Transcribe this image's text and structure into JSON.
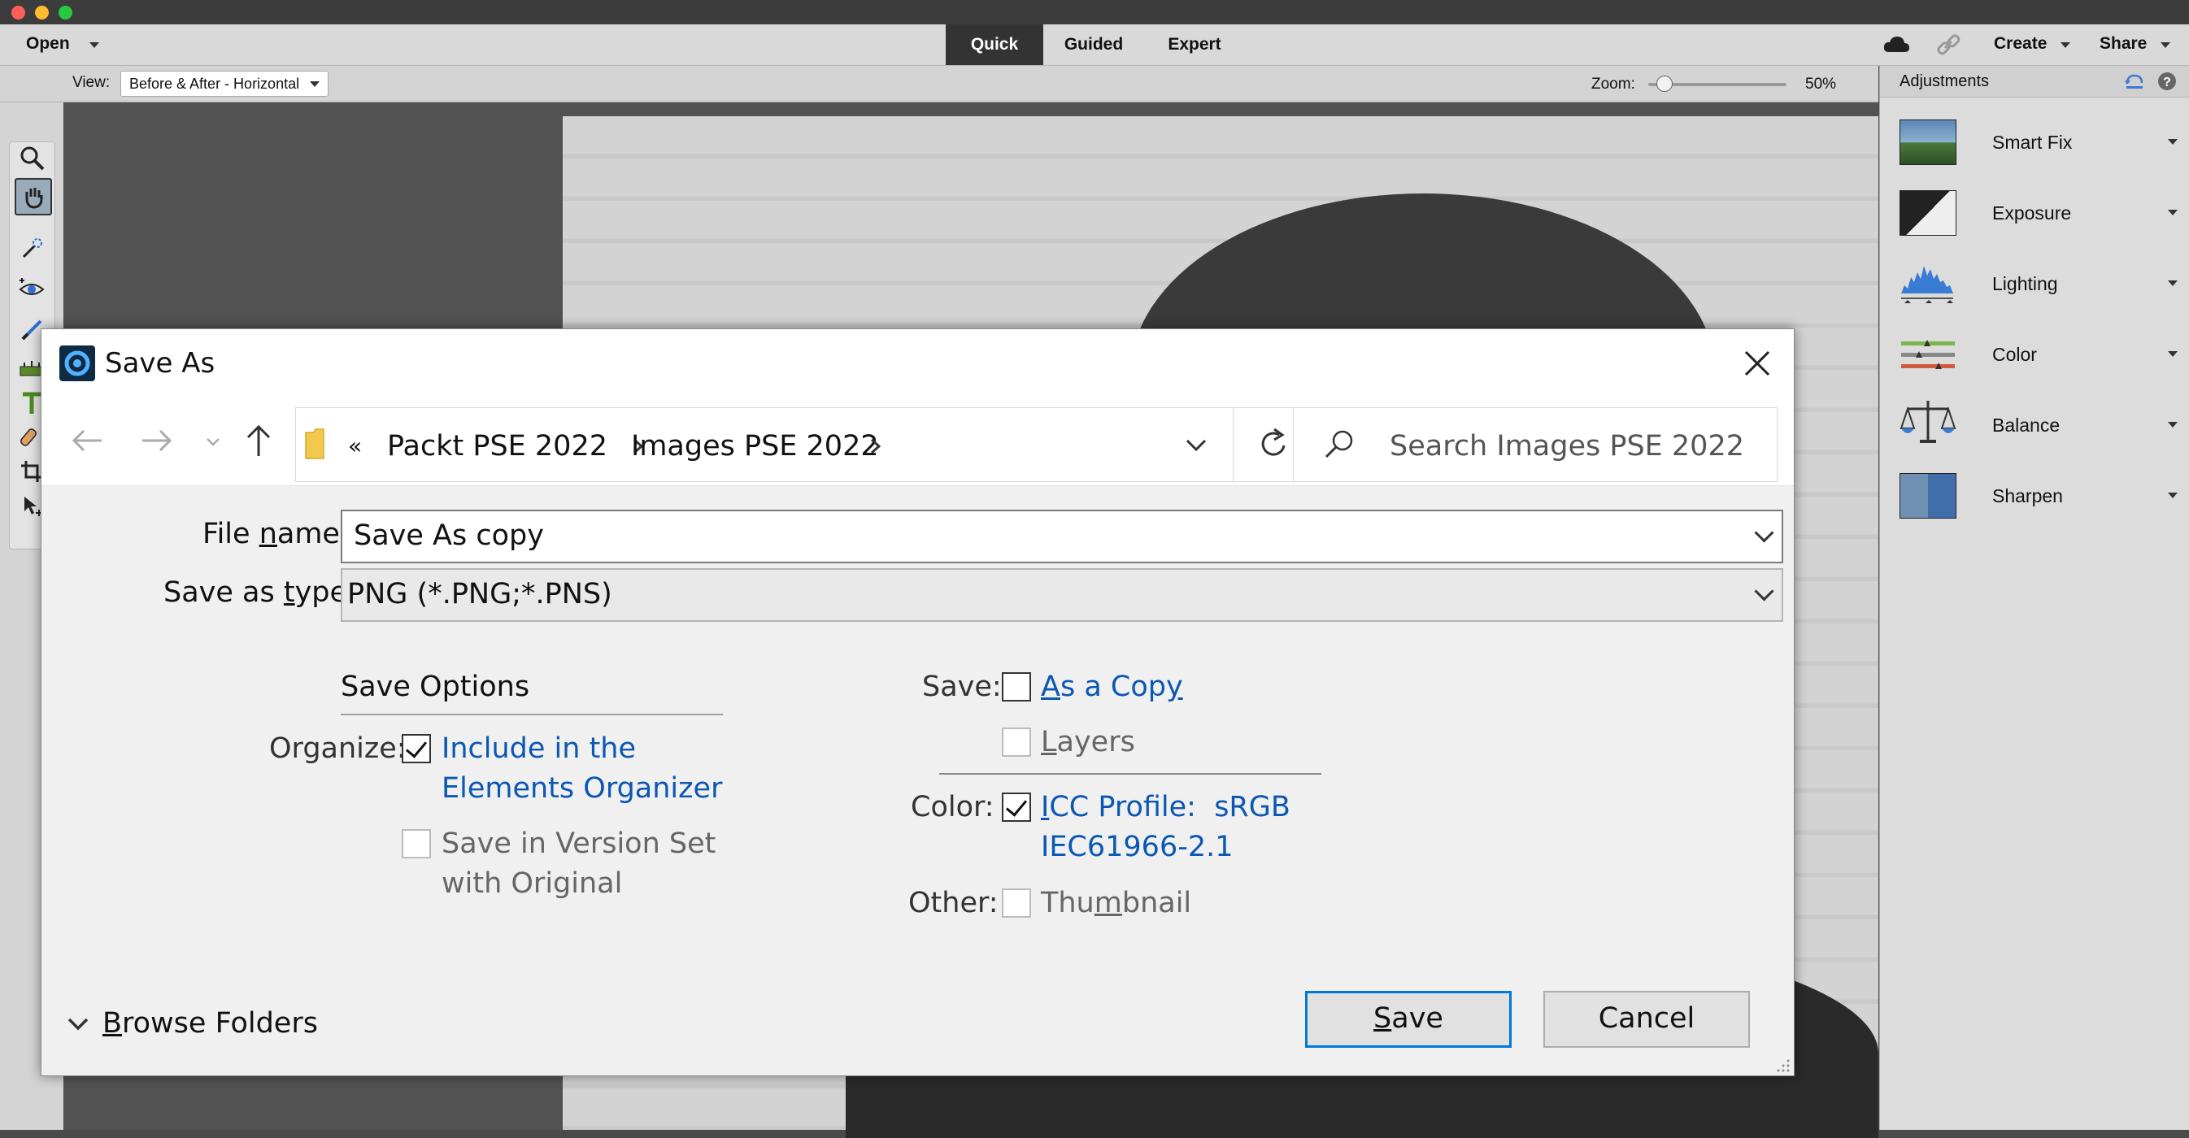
{
  "menubar": {
    "open_label": "Open",
    "modes": [
      "Quick",
      "Guided",
      "Expert"
    ],
    "active_mode": "Quick",
    "create_label": "Create",
    "share_label": "Share"
  },
  "options_bar": {
    "view_label": "View:",
    "view_value": "Before & After - Horizontal",
    "zoom_label": "Zoom:",
    "zoom_value": "50%",
    "zoom_fraction": 0.12
  },
  "panel": {
    "title": "Adjustments",
    "items": [
      {
        "label": "Smart Fix"
      },
      {
        "label": "Exposure"
      },
      {
        "label": "Lighting"
      },
      {
        "label": "Color"
      },
      {
        "label": "Balance"
      },
      {
        "label": "Sharpen"
      }
    ]
  },
  "dialog": {
    "title": "Save As",
    "breadcrumb_prefix": "«",
    "breadcrumb": [
      "Packt PSE 2022",
      "Images PSE 2022"
    ],
    "search_placeholder": "Search Images PSE 2022",
    "file_name_label": "File name:",
    "file_name_value": "Save As copy",
    "save_type_label": "Save as type:",
    "save_type_value": "PNG (*.PNG;*.PNS)",
    "save_options_heading": "Save Options",
    "organize_label": "Organize:",
    "include_organizer_1": "Include in the",
    "include_organizer_2": "Elements Organizer",
    "version_set_1": "Save in Version Set",
    "version_set_2": "with Original",
    "save_label": "Save:",
    "as_copy": "As a Copy",
    "layers": "Layers",
    "color_label": "Color:",
    "icc_1": "ICC Profile:  sRGB",
    "icc_2": "IEC61966-2.1",
    "other_label": "Other:",
    "thumbnail": "Thumbnail",
    "browse_folders": "Browse Folders",
    "save_button": "Save",
    "cancel_button": "Cancel",
    "include_organizer_checked": true,
    "version_set_checked": false,
    "as_copy_checked": false,
    "layers_checked": false,
    "icc_checked": true,
    "thumbnail_checked": false
  }
}
